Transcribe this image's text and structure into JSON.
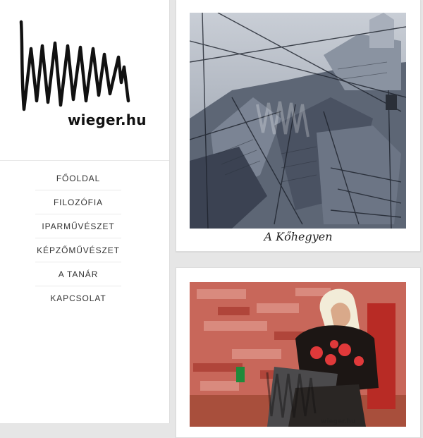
{
  "site": {
    "logo_text": "wieger.hu",
    "watermark": "wieger.hu"
  },
  "nav": {
    "items": [
      {
        "label": "FŐOLDAL"
      },
      {
        "label": "FILOZÓFIA"
      },
      {
        "label": "IPARMŰVÉSZET"
      },
      {
        "label": "KÉPZŐMŰVÉSZET"
      },
      {
        "label": "A TANÁR"
      },
      {
        "label": "KAPCSOLAT"
      }
    ]
  },
  "gallery": {
    "items": [
      {
        "caption": "A Kőhegyen"
      },
      {
        "caption": ""
      }
    ]
  },
  "colors": {
    "page_background": "#e6e6e6",
    "sidebar_background": "#ffffff",
    "text": "#333333"
  },
  "icons": {
    "logo": "handwritten-zigzag-signature"
  }
}
